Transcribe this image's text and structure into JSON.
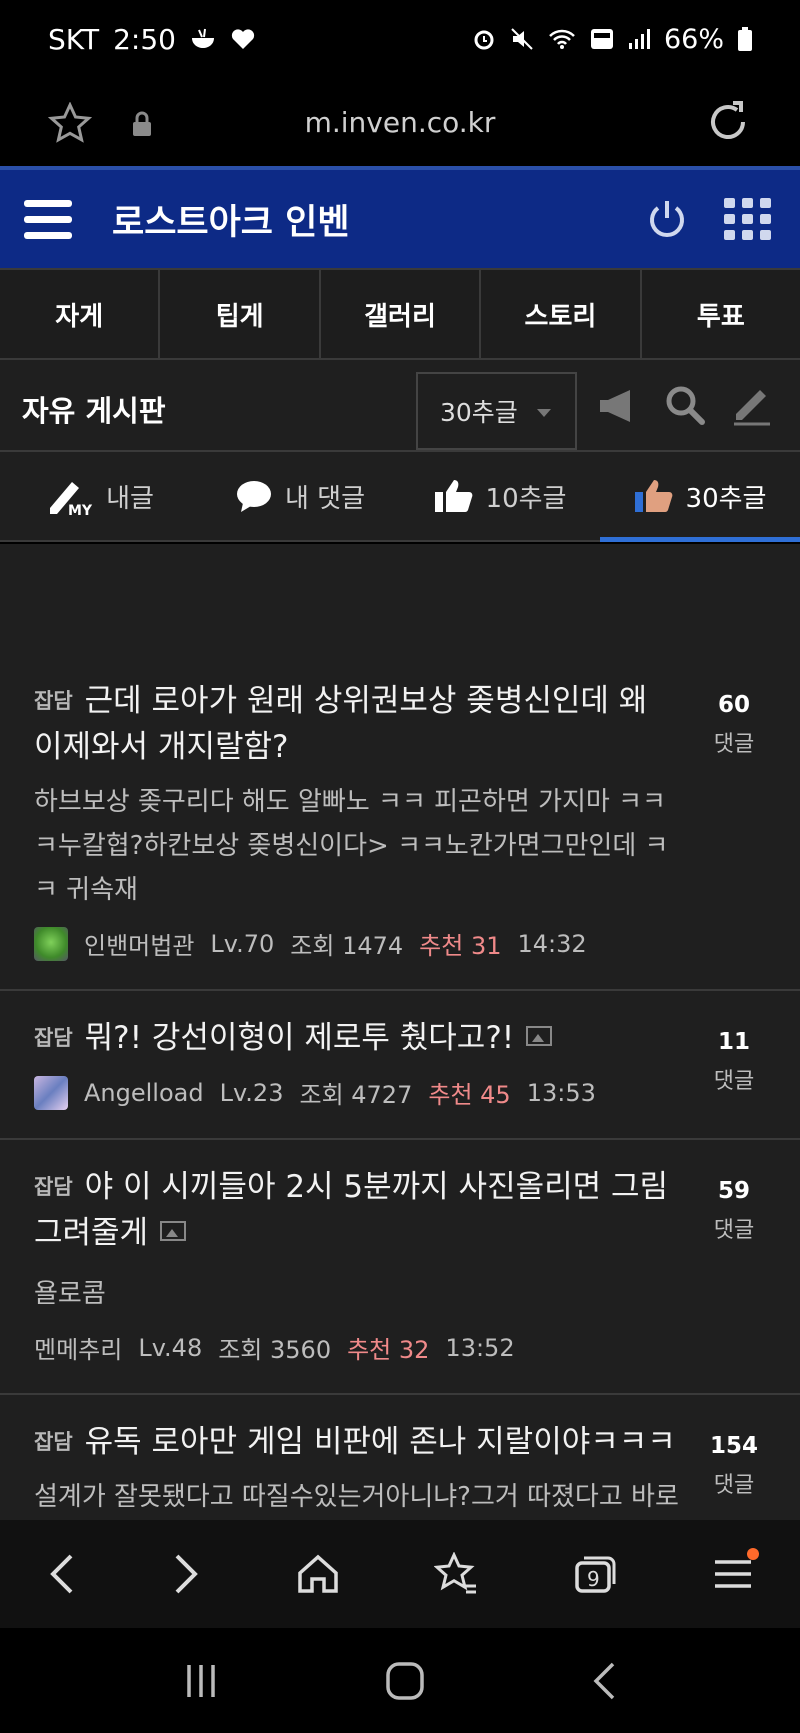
{
  "status": {
    "carrier": "SKT",
    "time": "2:50",
    "battery": "66%"
  },
  "browser": {
    "url": "m.inven.co.kr"
  },
  "app": {
    "title": "로스트아크 인벤"
  },
  "tabs": [
    "자게",
    "팁게",
    "갤러리",
    "스토리",
    "투표"
  ],
  "board": {
    "name": "자유 게시판",
    "sort_selected": "30추글"
  },
  "filters": [
    {
      "label": "내글",
      "icon": "pencil-my-icon"
    },
    {
      "label": "내 댓글",
      "icon": "speech-bubble-icon"
    },
    {
      "label": "10추글",
      "icon": "thumbs-up-icon"
    },
    {
      "label": "30추글",
      "icon": "thumbs-up-color-icon",
      "active": true
    }
  ],
  "posts": [
    {
      "category": "잡담",
      "title": "근데 로아가 원래 상위권보상 좆병신인데 왜 이제와서 개지랄함?",
      "preview": "하브보상 좆구리다 해도 알빠노 ㅋㅋ 피곤하면 가지마 ㅋㅋㅋ누칼협?하칸보상 좆병신이다> ㅋㅋ노칸가면그만인데 ㅋㅋ 귀속재",
      "author": "인밴머법관",
      "level": "Lv.70",
      "views": "조회 1474",
      "likes": "추천 31",
      "time": "14:32",
      "comments": "60",
      "comments_label": "댓글",
      "has_image": false
    },
    {
      "category": "잡담",
      "title": "뭐?! 강선이형이 제로투 췄다고?!",
      "preview": "",
      "author": "Angelload",
      "level": "Lv.23",
      "views": "조회 4727",
      "likes": "추천 45",
      "time": "13:53",
      "comments": "11",
      "comments_label": "댓글",
      "has_image": true
    },
    {
      "category": "잡담",
      "title": "야 이 시끼들아 2시 5분까지 사진올리면 그림 그려줄게",
      "preview": "욜로콤",
      "author": "멘메추리",
      "level": "Lv.48",
      "views": "조회 3560",
      "likes": "추천 32",
      "time": "13:52",
      "comments": "59",
      "comments_label": "댓글",
      "has_image": true
    },
    {
      "category": "잡담",
      "title": "유독 로아만 게임 비판에 존나 지랄이야ㅋㅋㅋ",
      "preview": "설계가 잘못됐다고 따질수있는거아니냐?그거 따졌다고 바로 갓",
      "author": "",
      "level": "",
      "views": "",
      "likes": "",
      "time": "",
      "comments": "154",
      "comments_label": "댓글",
      "has_image": false
    }
  ],
  "colors": {
    "app_bar": "#0d2a86",
    "active_tab": "#2f6fd6",
    "likes": "#f08a8a",
    "notification_dot": "#ff6a2b"
  }
}
